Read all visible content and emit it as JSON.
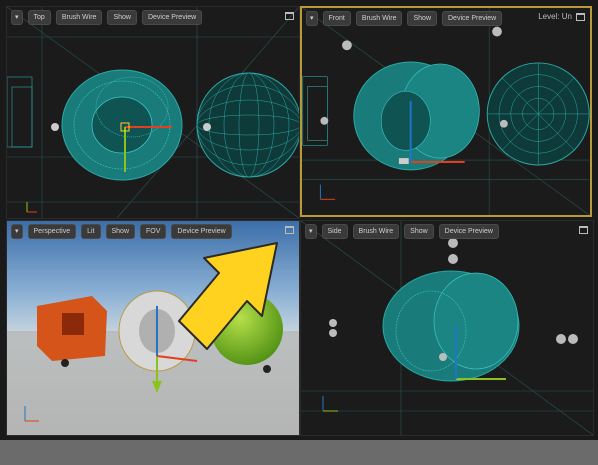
{
  "viewports": {
    "top": {
      "mode_label": "Top",
      "view_mode": "Brush Wire",
      "show_label": "Show",
      "device_preview": "Device Preview"
    },
    "front": {
      "mode_label": "Front",
      "view_mode": "Brush Wire",
      "show_label": "Show",
      "device_preview": "Device Preview",
      "level_label": "Level: Un"
    },
    "perspective": {
      "mode_label": "Perspective",
      "view_mode": "Lit",
      "show_label": "Show",
      "fov_label": "FOV",
      "device_preview": "Device Preview"
    },
    "side": {
      "mode_label": "Side",
      "view_mode": "Brush Wire",
      "show_label": "Show",
      "device_preview": "Device Preview"
    }
  },
  "colors": {
    "wire": "#2aa8a4",
    "highlight": "#ffd21f",
    "active_border": "#b89a3a"
  },
  "icons": {
    "menu": "chevron-down-icon",
    "maximize": "maximize-icon",
    "arrow": "yellow-pointer-arrow"
  }
}
